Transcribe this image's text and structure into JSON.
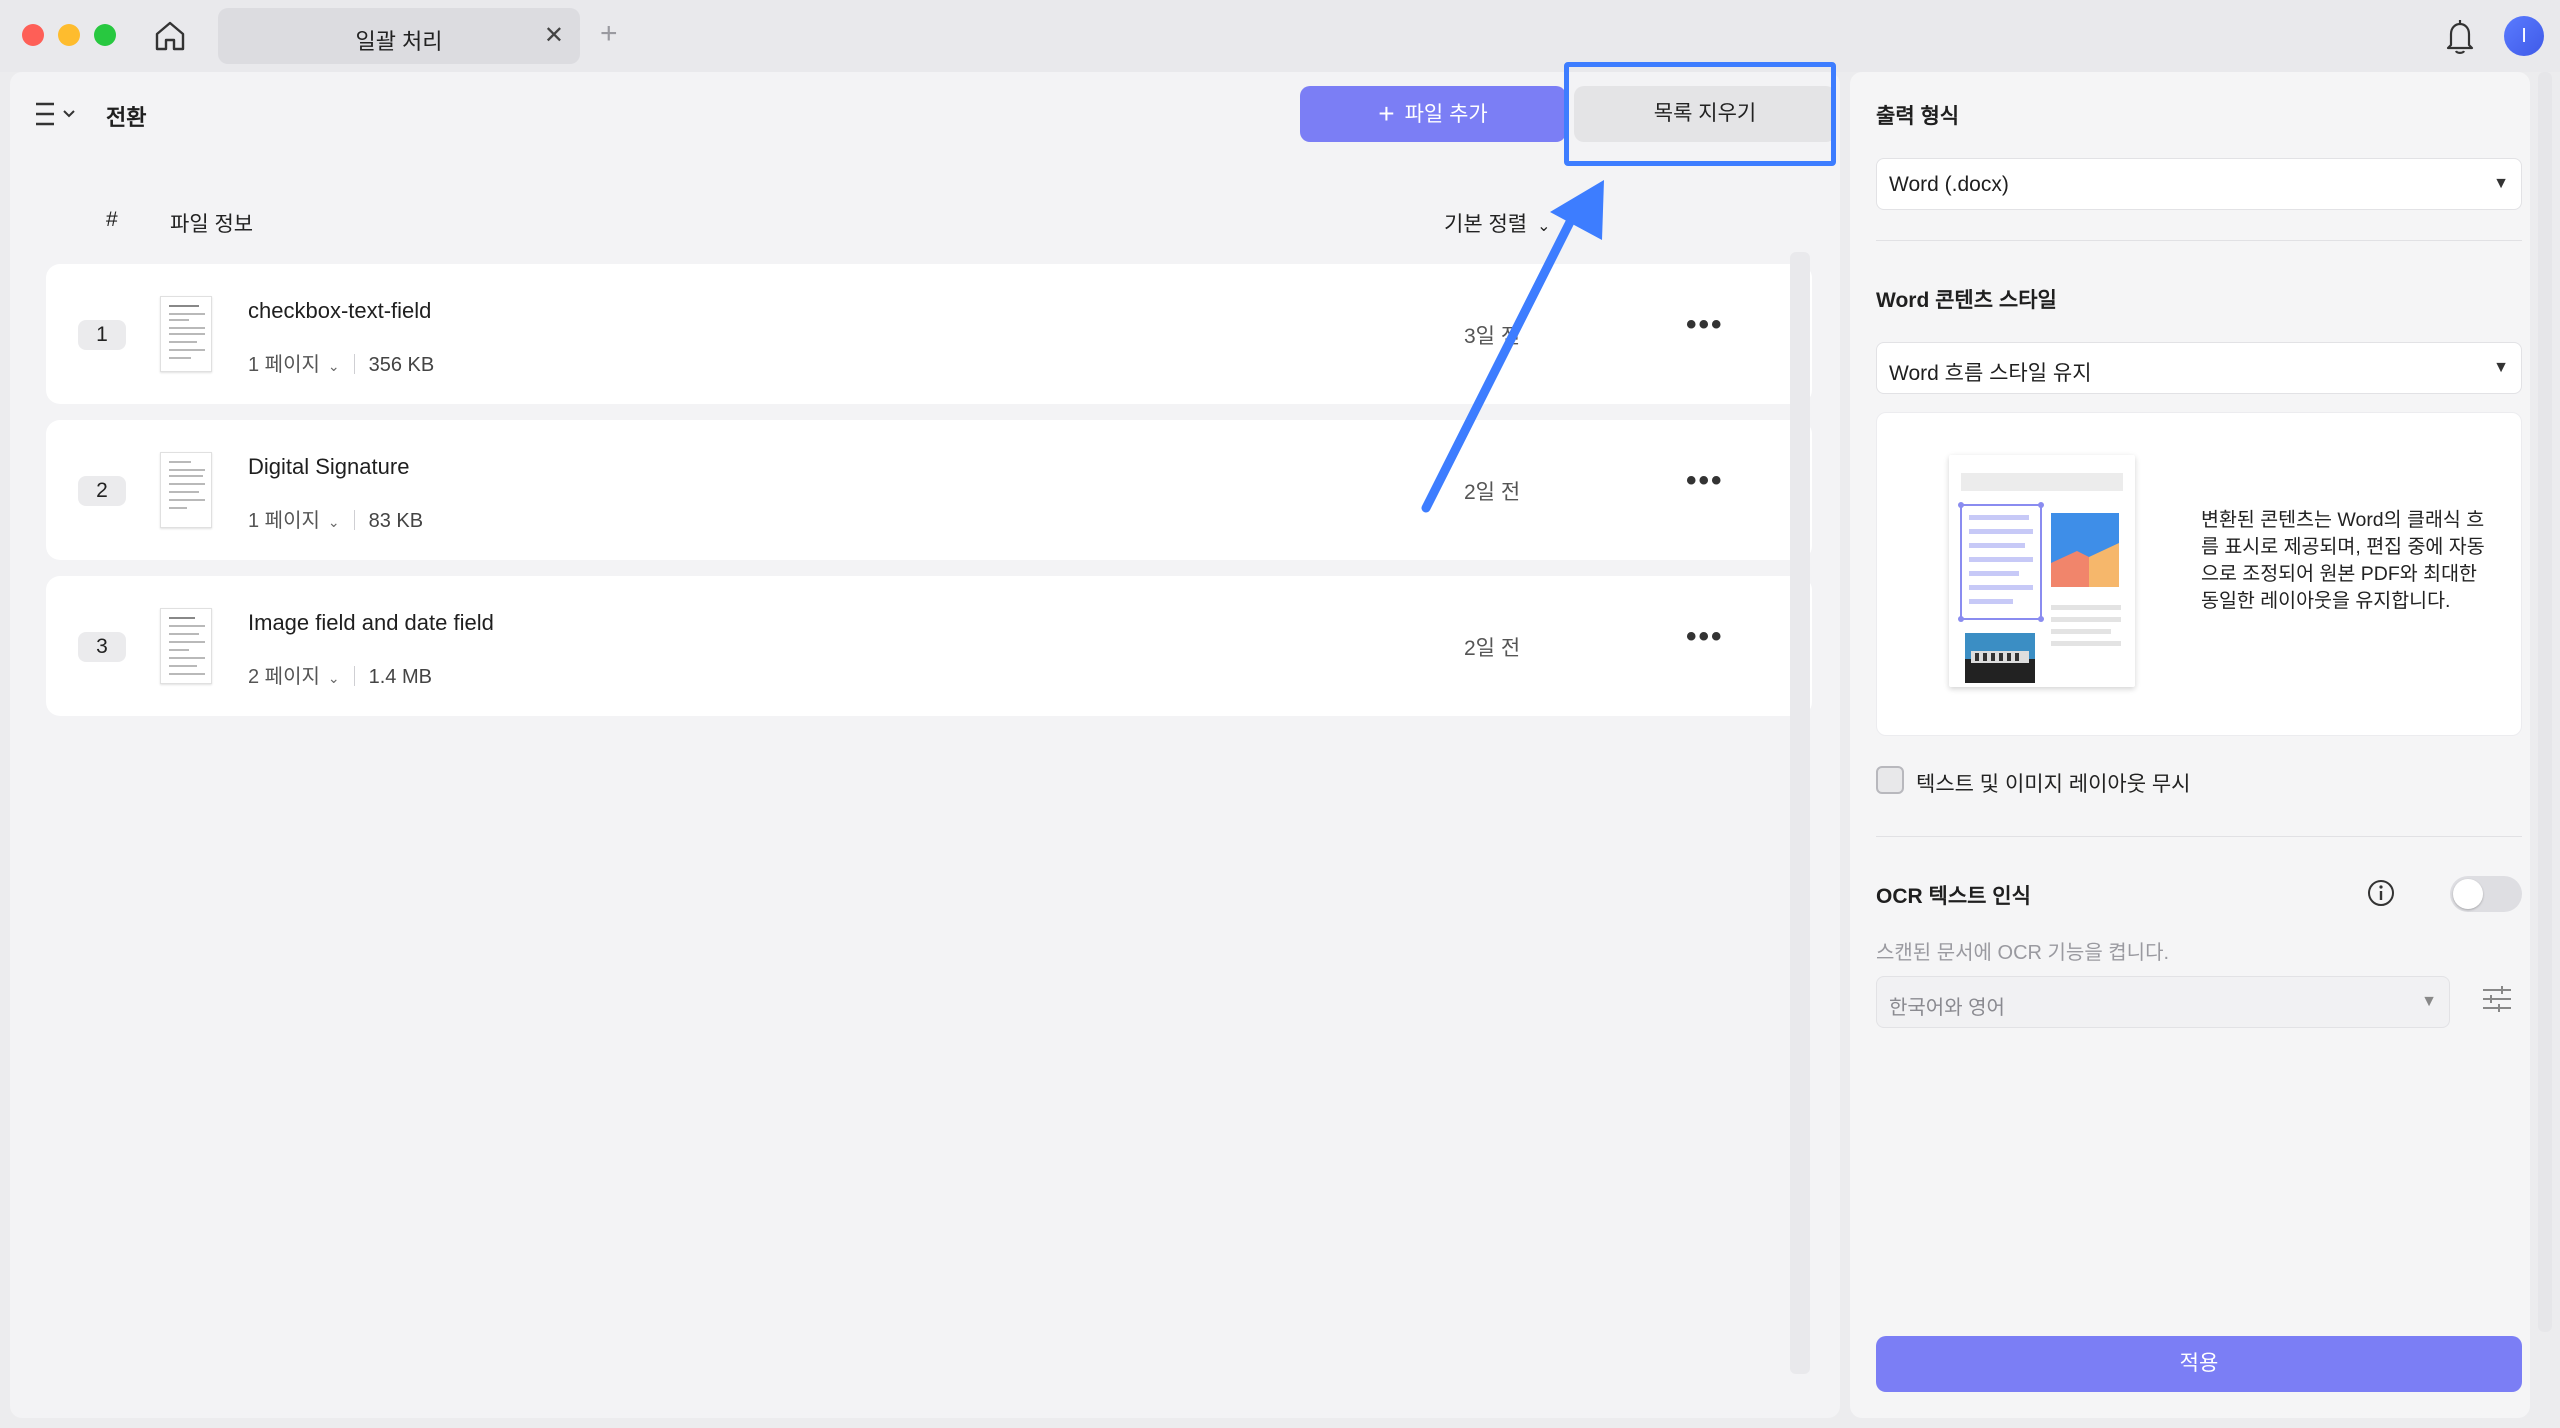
{
  "window": {
    "tab_title": "일괄 처리",
    "tab_close": "✕",
    "tab_add": "+",
    "avatar_initial": "I"
  },
  "toolbar": {
    "section": "전환",
    "add_file_label": "파일 추가",
    "clear_list_label": "목록 지우기"
  },
  "list": {
    "col_number": "#",
    "col_file_info": "파일 정보",
    "sort_label": "기본 정렬",
    "files": [
      {
        "index": "1",
        "name": "checkbox-text-field",
        "pages": "1 페이지",
        "size": "356 KB",
        "modified": "3일 전"
      },
      {
        "index": "2",
        "name": "Digital Signature",
        "pages": "1 페이지",
        "size": "83 KB",
        "modified": "2일 전"
      },
      {
        "index": "3",
        "name": "Image field and date field",
        "pages": "2 페이지",
        "size": "1.4 MB",
        "modified": "2일 전"
      }
    ]
  },
  "settings": {
    "output_format_title": "출력 형식",
    "output_format_value": "Word (.docx)",
    "content_style_title": "Word 콘텐츠 스타일",
    "content_style_value": "Word 흐름 스타일 유지",
    "style_description": "변환된 콘텐츠는 Word의 클래식 흐름 표시로 제공되며, 편집 중에 자동으로 조정되어 원본 PDF와 최대한 동일한 레이아웃을 유지합니다.",
    "ignore_layout_label": "텍스트 및 이미지 레이아웃 무시",
    "ocr_title": "OCR 텍스트 인식",
    "ocr_description": "스캔된 문서에 OCR 기능을 켭니다.",
    "ocr_language": "한국어와 영어",
    "ocr_enabled": false,
    "apply_label": "적용"
  },
  "colors": {
    "accent": "#7b7ef5",
    "highlight": "#3d7dff"
  }
}
